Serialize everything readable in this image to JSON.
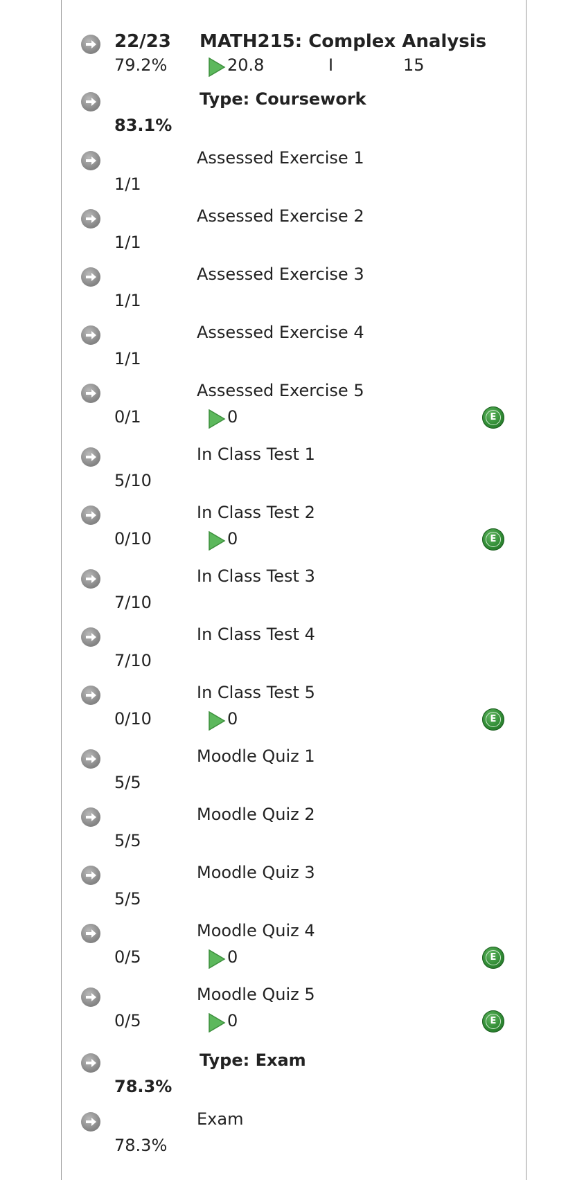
{
  "module": {
    "score": "22/23",
    "percent": "79.2%",
    "title": "MATH215: Complex Analysis",
    "play_value": "20.8",
    "level": "I",
    "credits": "15"
  },
  "coursework": {
    "label": "Type: Coursework",
    "percent": "83.1%",
    "items": [
      {
        "name": "Assessed Exercise 1",
        "score": "1/1"
      },
      {
        "name": "Assessed Exercise 2",
        "score": "1/1"
      },
      {
        "name": "Assessed Exercise 3",
        "score": "1/1"
      },
      {
        "name": "Assessed Exercise 4",
        "score": "1/1"
      },
      {
        "name": "Assessed Exercise 5",
        "score": "0/1",
        "play_value": "0",
        "badge": "E"
      },
      {
        "name": "In Class Test 1",
        "score": "5/10"
      },
      {
        "name": "In Class Test 2",
        "score": "0/10",
        "play_value": "0",
        "badge": "E"
      },
      {
        "name": "In Class Test 3",
        "score": "7/10"
      },
      {
        "name": "In Class Test 4",
        "score": "7/10"
      },
      {
        "name": "In Class Test 5",
        "score": "0/10",
        "play_value": "0",
        "badge": "E"
      },
      {
        "name": "Moodle Quiz 1",
        "score": "5/5"
      },
      {
        "name": "Moodle Quiz 2",
        "score": "5/5"
      },
      {
        "name": "Moodle Quiz 3",
        "score": "5/5"
      },
      {
        "name": "Moodle Quiz 4",
        "score": "0/5",
        "play_value": "0",
        "badge": "E"
      },
      {
        "name": "Moodle Quiz 5",
        "score": "0/5",
        "play_value": "0",
        "badge": "E"
      }
    ]
  },
  "exam": {
    "label": "Type: Exam",
    "percent": "78.3%",
    "items": [
      {
        "name": "Exam",
        "score": "78.3%"
      }
    ]
  },
  "colors": {
    "arrow": "#8a8a8a",
    "play": "#5cb85c",
    "badge": "#2f8a33"
  }
}
